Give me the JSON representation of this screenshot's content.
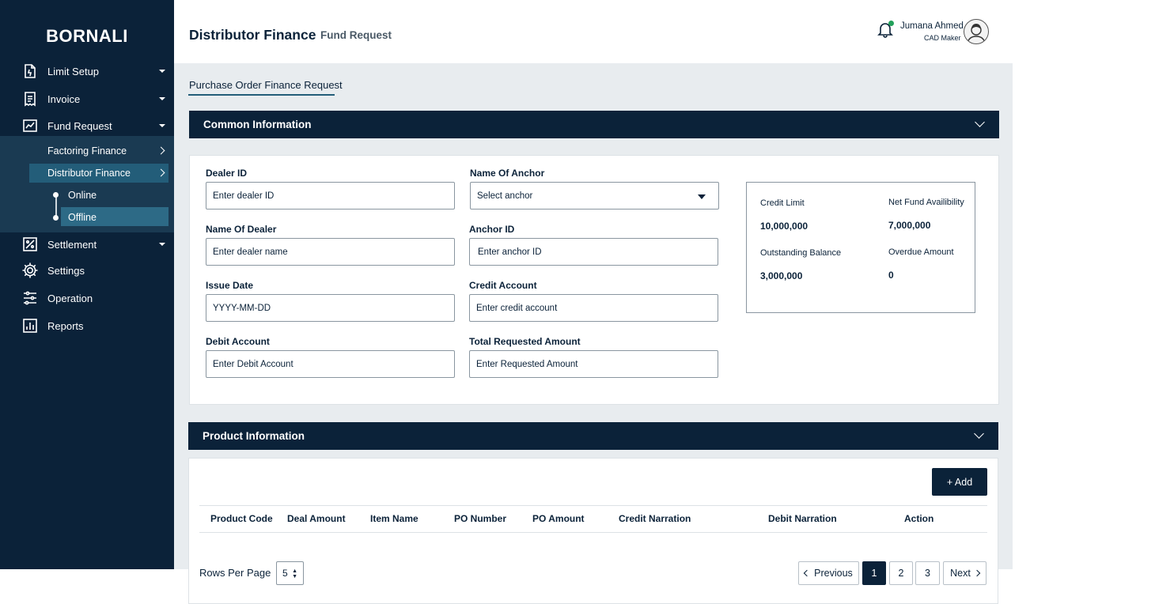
{
  "sidebar": {
    "brand": "BORNALI",
    "items": [
      {
        "label": "Limit Setup"
      },
      {
        "label": "Invoice"
      },
      {
        "label": "Fund Request"
      },
      {
        "label": "Settlement"
      },
      {
        "label": "Settings"
      },
      {
        "label": "Operation"
      },
      {
        "label": "Reports"
      }
    ],
    "fund_request_sub": [
      {
        "label": "Factoring Finance"
      },
      {
        "label": "Distributor Finance"
      }
    ],
    "distributor_sub": [
      {
        "label": "Online"
      },
      {
        "label": "Offline"
      }
    ]
  },
  "header": {
    "title": "Distributor Finance",
    "subtitle": "Fund Request",
    "user_name": "Jumana Ahmed",
    "user_role": "CAD Maker"
  },
  "tab": {
    "label": "Purchase Order Finance Request"
  },
  "common": {
    "title": "Common Information",
    "dealer_id": {
      "label": "Dealer ID",
      "placeholder": "Enter dealer ID"
    },
    "anchor_name": {
      "label": "Name Of Anchor",
      "value": "Select anchor"
    },
    "dealer_name": {
      "label": "Name Of Dealer",
      "placeholder": "Enter dealer name"
    },
    "anchor_id": {
      "label": "Anchor ID",
      "placeholder": "Enter anchor ID"
    },
    "issue_date": {
      "label": "Issue Date",
      "placeholder": "YYYY-MM-DD"
    },
    "credit_account": {
      "label": "Credit Account",
      "placeholder": "Enter credit account"
    },
    "debit_account": {
      "label": "Debit Account",
      "placeholder": "Enter Debit Account"
    },
    "total_amount": {
      "label": "Total Requested Amount",
      "placeholder": "Enter Requested Amount"
    }
  },
  "summary": {
    "credit_limit_label": "Credit Limit",
    "credit_limit_value": "10,000,000",
    "net_fund_label": "Net Fund Availibility",
    "net_fund_value": "7,000,000",
    "outstanding_label": "Outstanding Balance",
    "outstanding_value": "3,000,000",
    "overdue_label": "Overdue Amount",
    "overdue_value": "0"
  },
  "product": {
    "title": "Product Information",
    "add_label": "+ Add",
    "columns": [
      "Product Code",
      "Deal Amount",
      "Item Name",
      "PO Number",
      "PO Amount",
      "Credit Narration",
      "Debit Narration",
      "Action"
    ]
  },
  "pagination": {
    "rows_label": "Rows Per Page",
    "rows_value": "5",
    "previous": "Previous",
    "next": "Next",
    "pages": [
      "1",
      "2",
      "3"
    ]
  },
  "colors": {
    "primary": "#0b2239",
    "accent": "#235d79",
    "notify": "#22a05a"
  }
}
